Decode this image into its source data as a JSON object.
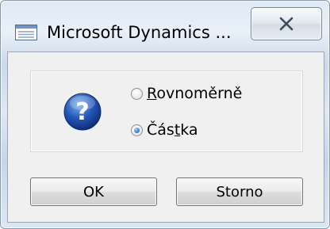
{
  "window": {
    "title": "Microsoft Dynamics ...",
    "app_icon": "form-icon",
    "close_icon": "close-icon"
  },
  "dialog": {
    "icon": "question-icon",
    "options": [
      {
        "pre": "",
        "accel": "R",
        "post": "ovnoměrně",
        "checked": false
      },
      {
        "pre": "Čás",
        "accel": "t",
        "post": "ka",
        "checked": true
      }
    ],
    "buttons": {
      "ok_label": "OK",
      "cancel_label": "Storno"
    }
  },
  "colors": {
    "question_blue": "#1f4fb0",
    "radio_selected": "#2f7fd0"
  }
}
